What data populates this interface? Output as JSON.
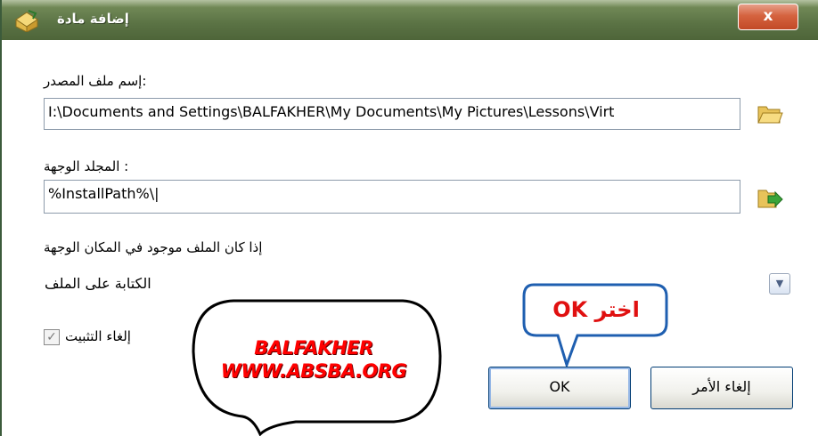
{
  "window": {
    "title": "إضافة مادة",
    "close_label": "x"
  },
  "source": {
    "label": ":إسم ملف المصدر",
    "value": "I:\\Documents and Settings\\BALFAKHER\\My Documents\\My Pictures\\Lessons\\Virt",
    "browse_icon": "folder-open-icon"
  },
  "destination": {
    "label": ": المجلد الوجهة",
    "value": "%InstallPath%\\|",
    "browse_icon": "folder-arrow-icon"
  },
  "overwrite": {
    "label": "إذا كان الملف موجود في المكان الوجهة",
    "selected": "الكتابة على الملف"
  },
  "uninstall": {
    "label": "إلغاء التثبيت",
    "checked": true
  },
  "buttons": {
    "ok_label": "OK",
    "cancel_label": "إلغاء الأمر"
  },
  "annotations": {
    "callout_text": "اختر OK",
    "watermark_line1": "BALFAKHER",
    "watermark_line2": "WWW.ABSBA.ORG"
  },
  "colors": {
    "titlebar": "#5a7244",
    "callout_border": "#1f5fb0",
    "annotation_text": "#e01010"
  }
}
